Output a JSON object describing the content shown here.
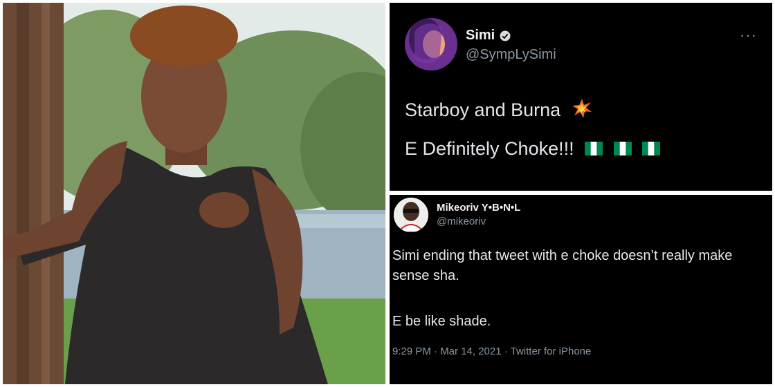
{
  "photo": {
    "subject": "woman-by-lake-photo"
  },
  "tweet_top": {
    "display_name": "Simi",
    "handle": "@SympLySimi",
    "more": "···",
    "line1": "Starboy and Burna",
    "line2": "E Definitely Choke!!!",
    "flags": [
      "ng",
      "ng",
      "ng"
    ]
  },
  "tweet_bottom": {
    "display_name": "Mikeoriv Y•B•N•L",
    "handle": "@mikeoriv",
    "text": "Simi ending that tweet with e choke doesn’t really make sense sha.",
    "text2": "E be like shade.",
    "meta": "9:29 PM · Mar 14, 2021 · Twitter for iPhone"
  },
  "colors": {
    "tweet_bg": "#000000",
    "muted": "#8b98a5",
    "verified": "#d9d9d9",
    "flag_green": "#008751"
  }
}
